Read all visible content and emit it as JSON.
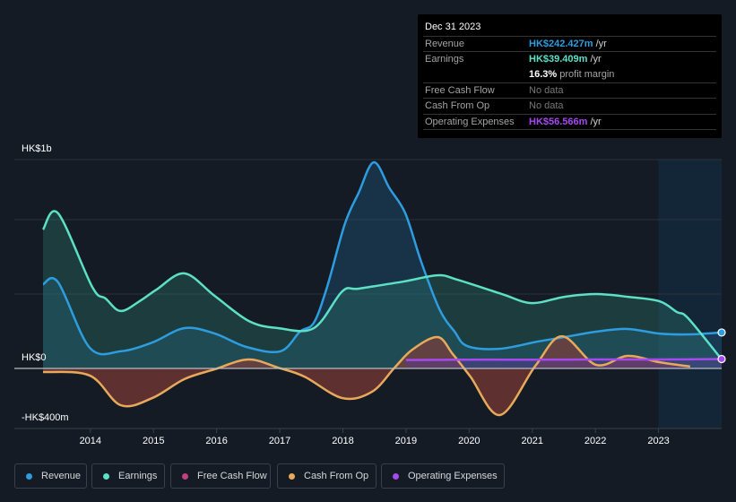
{
  "tooltip": {
    "date": "Dec 31 2023",
    "rows": [
      {
        "label": "Revenue",
        "value": "HK$242.427m",
        "unit": " /yr",
        "color": "#2d9de0"
      },
      {
        "label": "Earnings",
        "value": "HK$39.409m",
        "unit": " /yr",
        "color": "#5ce0c6"
      },
      {
        "label": "",
        "value": "16.3%",
        "unit": " profit margin",
        "color": "#ffffff"
      },
      {
        "label": "Free Cash Flow",
        "value": "No data",
        "unit": "",
        "color": "#777777"
      },
      {
        "label": "Cash From Op",
        "value": "No data",
        "unit": "",
        "color": "#777777"
      },
      {
        "label": "Operating Expenses",
        "value": "HK$56.566m",
        "unit": " /yr",
        "color": "#a64af0"
      }
    ]
  },
  "legend": [
    {
      "label": "Revenue",
      "color": "#2d9de0"
    },
    {
      "label": "Earnings",
      "color": "#5ce0c6"
    },
    {
      "label": "Free Cash Flow",
      "color": "#c2407f"
    },
    {
      "label": "Cash From Op",
      "color": "#e8aa5a"
    },
    {
      "label": "Operating Expenses",
      "color": "#a64af0"
    }
  ],
  "chart_data": {
    "type": "area",
    "title": "",
    "xlabel": "",
    "ylabel": "",
    "y_tick_labels": [
      "HK$1b",
      "HK$0",
      "-HK$400m"
    ],
    "x_tick_labels": [
      "2014",
      "2015",
      "2016",
      "2017",
      "2018",
      "2019",
      "2020",
      "2021",
      "2022",
      "2023"
    ],
    "x_ticks": [
      2014,
      2015,
      2016,
      2017,
      2018,
      2019,
      2020,
      2021,
      2022,
      2023
    ],
    "xlim": [
      2013.25,
      2024.0
    ],
    "ylim": [
      -290,
      1000
    ],
    "unit": "HK$ millions",
    "highlight_from": 2023.0,
    "series": [
      {
        "name": "Revenue",
        "color": "#2d9de0",
        "points": [
          [
            2013.25,
            403
          ],
          [
            2013.49,
            412
          ],
          [
            2013.99,
            99
          ],
          [
            2014.48,
            82
          ],
          [
            2014.98,
            124
          ],
          [
            2015.49,
            193
          ],
          [
            2015.97,
            167
          ],
          [
            2016.47,
            103
          ],
          [
            2017.01,
            82
          ],
          [
            2017.32,
            176
          ],
          [
            2017.54,
            219
          ],
          [
            2017.75,
            390
          ],
          [
            2018.03,
            691
          ],
          [
            2018.25,
            841
          ],
          [
            2018.49,
            987
          ],
          [
            2018.74,
            862
          ],
          [
            2018.99,
            742
          ],
          [
            2019.24,
            511
          ],
          [
            2019.53,
            283
          ],
          [
            2019.77,
            176
          ],
          [
            2019.97,
            107
          ],
          [
            2020.48,
            94
          ],
          [
            2021.09,
            129
          ],
          [
            2021.51,
            150
          ],
          [
            2022.01,
            176
          ],
          [
            2022.51,
            189
          ],
          [
            2023.01,
            167
          ],
          [
            2023.5,
            163
          ],
          [
            2024.0,
            172
          ]
        ]
      },
      {
        "name": "Earnings",
        "color": "#5ce0c6",
        "points": [
          [
            2013.25,
            665
          ],
          [
            2013.49,
            742
          ],
          [
            2014.03,
            390
          ],
          [
            2014.24,
            335
          ],
          [
            2014.48,
            275
          ],
          [
            2014.8,
            326
          ],
          [
            2015.05,
            378
          ],
          [
            2015.49,
            455
          ],
          [
            2015.97,
            347
          ],
          [
            2016.51,
            227
          ],
          [
            2016.97,
            193
          ],
          [
            2017.54,
            193
          ],
          [
            2017.99,
            369
          ],
          [
            2018.25,
            382
          ],
          [
            2018.96,
            416
          ],
          [
            2019.5,
            446
          ],
          [
            2019.81,
            425
          ],
          [
            2020.52,
            356
          ],
          [
            2020.99,
            313
          ],
          [
            2021.51,
            343
          ],
          [
            2022.01,
            356
          ],
          [
            2022.51,
            343
          ],
          [
            2023.01,
            322
          ],
          [
            2023.29,
            270
          ],
          [
            2023.47,
            240
          ],
          [
            2024.0,
            43
          ]
        ]
      },
      {
        "name": "Free Cash Flow",
        "color": "#c2407f",
        "points": [
          [
            2013.25,
            -17
          ],
          [
            2013.99,
            -34
          ],
          [
            2014.48,
            -176
          ],
          [
            2014.98,
            -142
          ],
          [
            2015.49,
            -51
          ],
          [
            2015.97,
            -4
          ],
          [
            2016.5,
            43
          ],
          [
            2016.97,
            4
          ],
          [
            2017.39,
            -39
          ],
          [
            2017.99,
            -142
          ],
          [
            2018.46,
            -112
          ],
          [
            2018.82,
            4
          ],
          [
            2019.1,
            90
          ],
          [
            2019.5,
            150
          ],
          [
            2019.74,
            69
          ],
          [
            2020.02,
            -39
          ],
          [
            2020.49,
            -223
          ],
          [
            2021.05,
            13
          ],
          [
            2021.47,
            154
          ],
          [
            2022.01,
            17
          ],
          [
            2022.51,
            60
          ],
          [
            2023.01,
            30
          ],
          [
            2023.5,
            9
          ]
        ]
      },
      {
        "name": "Cash From Op",
        "color": "#e8aa5a",
        "points": [
          [
            2013.25,
            -17
          ],
          [
            2013.99,
            -34
          ],
          [
            2014.48,
            -176
          ],
          [
            2014.98,
            -142
          ],
          [
            2015.49,
            -51
          ],
          [
            2015.97,
            -4
          ],
          [
            2016.5,
            43
          ],
          [
            2016.97,
            4
          ],
          [
            2017.39,
            -39
          ],
          [
            2017.99,
            -142
          ],
          [
            2018.46,
            -112
          ],
          [
            2018.82,
            4
          ],
          [
            2019.1,
            90
          ],
          [
            2019.5,
            150
          ],
          [
            2019.74,
            69
          ],
          [
            2020.02,
            -39
          ],
          [
            2020.49,
            -223
          ],
          [
            2021.05,
            13
          ],
          [
            2021.47,
            154
          ],
          [
            2022.01,
            17
          ],
          [
            2022.51,
            60
          ],
          [
            2023.01,
            30
          ],
          [
            2023.5,
            9
          ]
        ]
      },
      {
        "name": "Operating Expenses",
        "color": "#a64af0",
        "points": [
          [
            2019.0,
            40
          ],
          [
            2020.0,
            42
          ],
          [
            2021.0,
            42
          ],
          [
            2022.0,
            43
          ],
          [
            2023.0,
            43
          ],
          [
            2024.0,
            45
          ]
        ]
      }
    ]
  }
}
